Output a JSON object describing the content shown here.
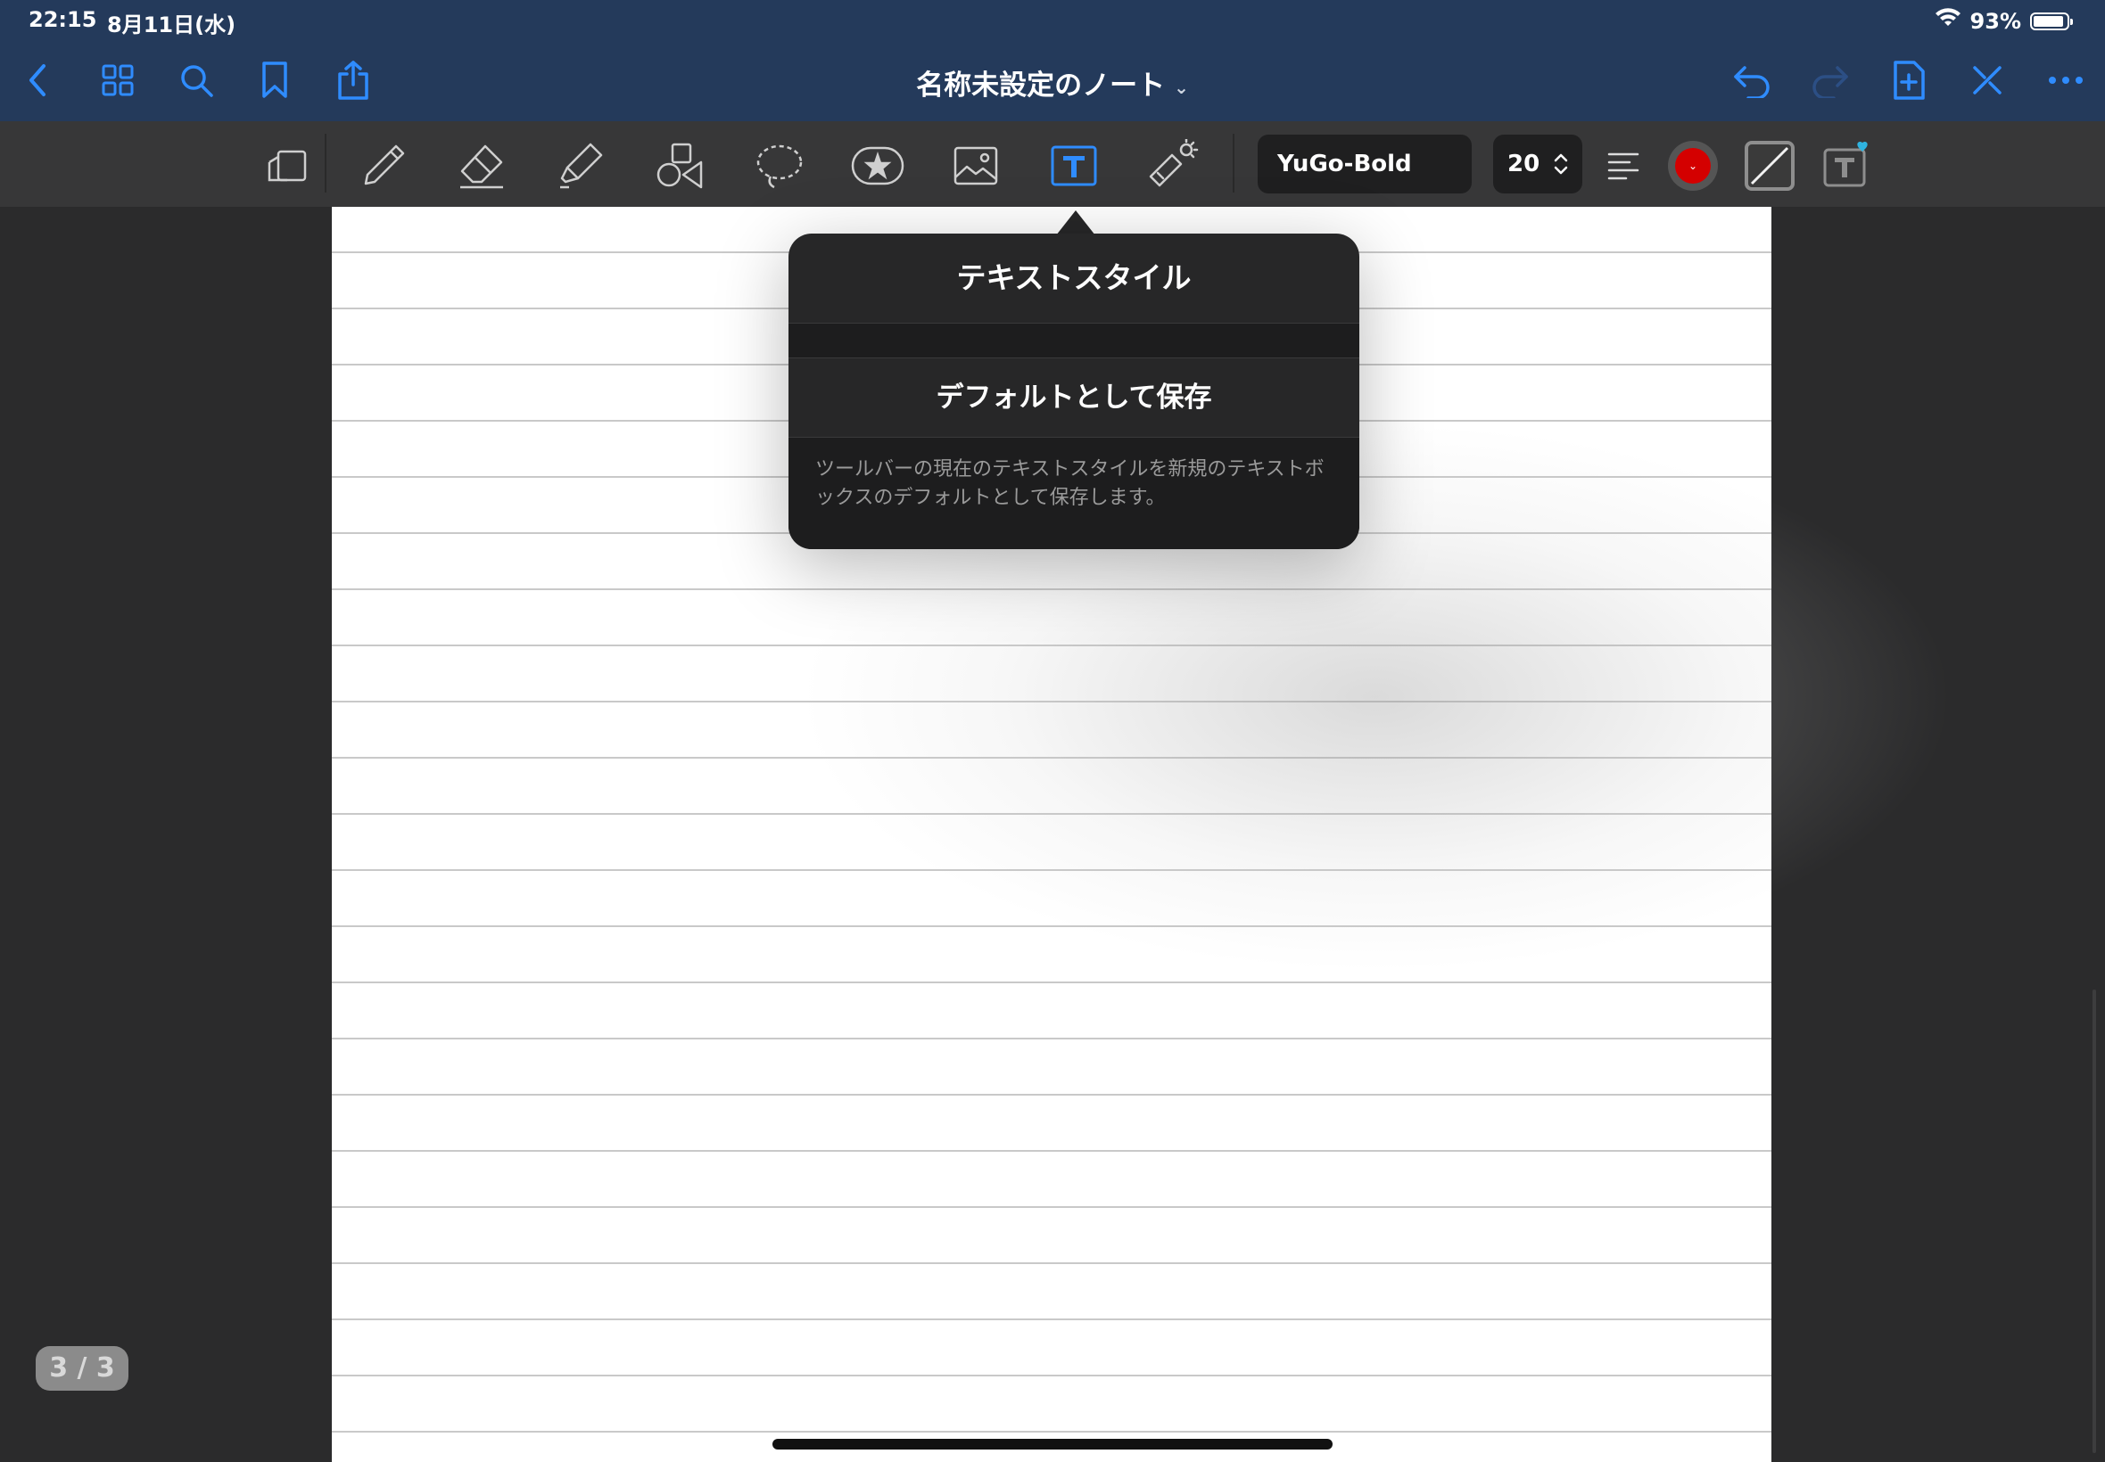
{
  "status_bar": {
    "time": "22:15",
    "date": "8月11日(水)",
    "battery_percent_label": "93%",
    "battery_level": 0.93,
    "icons": [
      "wifi-icon",
      "battery-icon"
    ]
  },
  "nav_bar": {
    "title": "名称未設定のノート",
    "left_icons": [
      "back-icon",
      "grid-icon",
      "search-icon",
      "bookmark-icon",
      "share-icon"
    ],
    "right_icons": [
      "undo-icon",
      "redo-icon",
      "add-page-icon",
      "close-tools-icon",
      "more-icon"
    ],
    "accent_color": "#2f8cff"
  },
  "toolbar": {
    "tools": [
      "scan-icon",
      "pen-icon",
      "eraser-icon",
      "highlighter-icon",
      "shapes-icon",
      "lasso-icon",
      "sticker-icon",
      "image-icon",
      "text-tool-icon",
      "laser-pointer-icon"
    ],
    "active_tool": "text-tool-icon",
    "font_name": "YuGo-Bold",
    "font_size": "20",
    "text_color": "#d40000",
    "alignment": "left",
    "extra_icons": [
      "align-icon",
      "color-icon",
      "border-color-icon",
      "text-style-favorite-icon"
    ]
  },
  "popover": {
    "title": "テキストスタイル",
    "action_label": "デフォルトとして保存",
    "description": "ツールバーの現在のテキストスタイルを新規のテキストボックスのデフォルトとして保存します。"
  },
  "page_counter": "3 / 3"
}
